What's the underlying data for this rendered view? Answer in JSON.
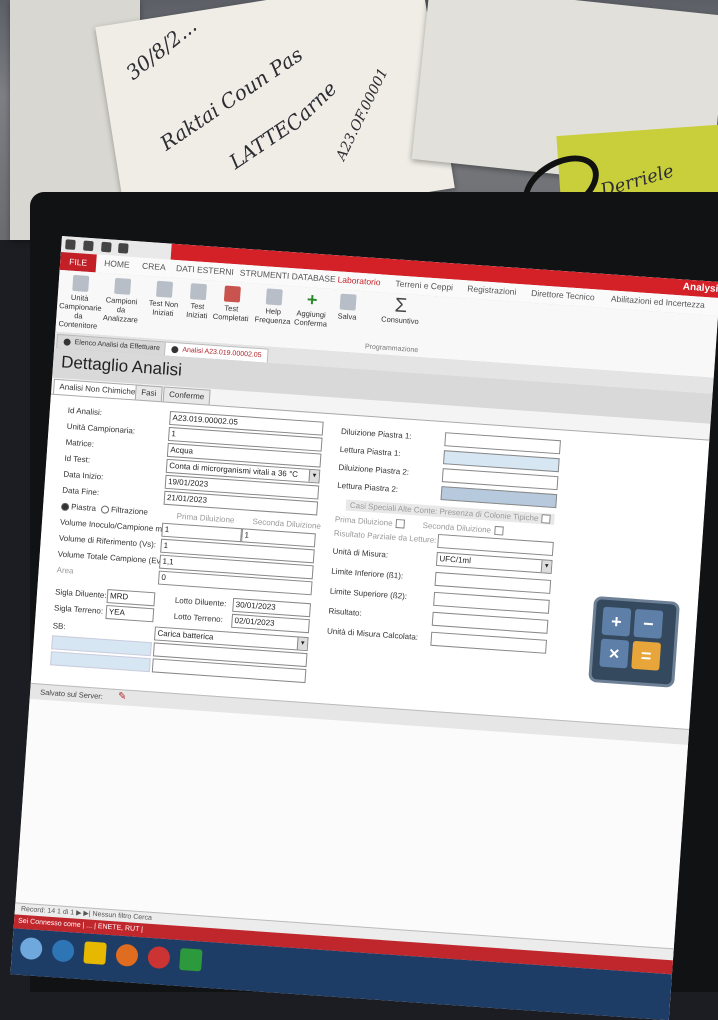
{
  "background": {
    "notes": [
      "30/8/2...",
      "Raktai Coun Pas",
      "LATTE",
      "Carne",
      "A23.OF.00001",
      "Derriele"
    ]
  },
  "window": {
    "app_title": "Analysis",
    "tabs": {
      "file": "FILE",
      "home": "HOME",
      "create": "CREA",
      "external": "DATI ESTERNI",
      "db_tools": "STRUMENTI DATABASE",
      "lab": "Laboratorio",
      "terreni": "Terreni e Ceppi",
      "registrazioni": "Registrazioni",
      "direttore": "Direttore Tecnico",
      "abilitazioni": "Abilitazioni ed Incertezza"
    },
    "ribbon": {
      "b1": [
        "Unità Campionarie",
        "da Contenitore"
      ],
      "b2": [
        "Campioni da",
        "Analizzare"
      ],
      "b3": [
        "Test Non",
        "Iniziati"
      ],
      "b4": [
        "Test",
        "Iniziati"
      ],
      "b5": [
        "Test",
        "Completati"
      ],
      "b6": [
        "Help",
        "Frequenza"
      ],
      "b7": [
        "Aggiungi",
        "Conferma"
      ],
      "b8": [
        "Salva",
        ""
      ],
      "b9": [
        "Consuntivo",
        ""
      ],
      "group_label": "Programmazione"
    },
    "doc_tabs": {
      "t1": "Elenco Analisi da Effettuare",
      "t2": "Analisi A23.019.00002.05"
    }
  },
  "page": {
    "title": "Dettaglio Analisi",
    "subtabs": {
      "s1": "Analisi Non Chimiche",
      "s2": "Fasi",
      "s3": "Conferme"
    }
  },
  "form": {
    "labels": {
      "id_analisi": "Id Analisi:",
      "unita": "Unità Campionaria:",
      "matrice": "Matrice:",
      "id_test": "Id Test:",
      "data_inizio": "Data Inizio:",
      "data_fine": "Data Fine:",
      "piastra": "Piastra",
      "filtrazione": "Filtrazione",
      "prima_diluizione": "Prima Diluizione",
      "seconda_diluizione": "Seconda Diluizione",
      "volume_inoculo": "Volume Inoculo/Campione ml",
      "volume_rif": "Volume di Riferimento (Vs):",
      "volume_totale": "Volume Totale Campione (Ev):",
      "area": "Area",
      "sigla_diluente": "Sigla Diluente:",
      "lotto_diluente": "Lotto Diluente:",
      "sigla_terreno": "Sigla Terreno:",
      "lotto_terreno": "Lotto Terreno:",
      "sb": "SB:",
      "diluizione_piastra_1": "Diluizione Piastra 1:",
      "lettura_piastra_1": "Lettura Piastra 1:",
      "diluizione_piastra_2": "Diluizione Piastra 2:",
      "lettura_piastra_2": "Lettura Piastra 2:",
      "casi_speciali": "Casi Speciali Alte Conte: Presenza di Colonie Tipiche",
      "prima_dil_r": "Prima Diluizione",
      "seconda_dil_r": "Seconda Diluizione",
      "risultato_parziale": "Risultato Parziale da Letture:",
      "unita_misura": "Unità di Misura:",
      "limite_inf": "Limite Inferiore (ß1):",
      "limite_sup": "Limite Superiore (ß2):",
      "risultato": "Risultato:",
      "unita_calcolata": "Unità di Misura Calcolata:"
    },
    "values": {
      "id_analisi": "A23.019.00002.05",
      "unita": "1",
      "matrice": "Acqua",
      "id_test": "Conta di microrganismi vitali a 36 °C",
      "data_inizio": "19/01/2023",
      "data_fine": "21/01/2023",
      "vol_inoculo_1": "1",
      "vol_inoculo_2": "1",
      "vol_rif": "1",
      "vol_tot": "1,1",
      "area": "0",
      "sigla_diluente": "MRD",
      "lotto_diluente": "30/01/2023",
      "sigla_terreno": "YEA",
      "lotto_terreno": "02/01/2023",
      "sb": "Carica batterica",
      "unita_misura": "UFC/1ml"
    }
  },
  "footer": {
    "save_label": "Salvato sul Server:",
    "nav": "Record: 14  1 di 1  ▶ ▶|   Nessun filtro  Cerca",
    "status": "Sei Connesso come | ... | ENETE, RUT |"
  },
  "colors": {
    "accent_red": "#d42027",
    "ribbon_bg": "#f8f8f8",
    "highlight_blue": "#d6e6f3",
    "calc_bg": "#34495e"
  }
}
